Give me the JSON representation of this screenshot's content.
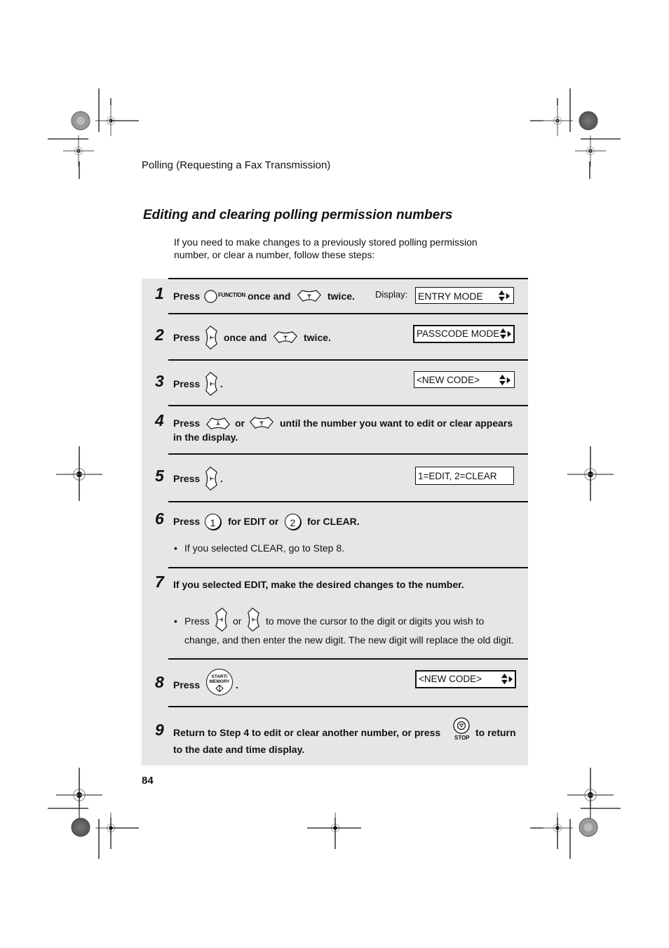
{
  "header": {
    "running_title": "Polling (Requesting a Fax Transmission)"
  },
  "section": {
    "title": "Editing and clearing polling permission numbers",
    "intro_line1": "If you need to make changes to a previously stored polling permission",
    "intro_line2": "number, or clear a number, follow these steps:"
  },
  "display_label": "Display:",
  "steps": [
    {
      "number": "1",
      "press": "Press",
      "function_label": "FUNCTION",
      "mid": "once and",
      "end": "twice.",
      "display": "ENTRY MODE"
    },
    {
      "number": "2",
      "press": "Press",
      "mid": "once and",
      "end": "twice.",
      "display": "PASSCODE MODE"
    },
    {
      "number": "3",
      "press": "Press",
      "end": ".",
      "display": "<NEW CODE>"
    },
    {
      "number": "4",
      "press": "Press",
      "mid": "or",
      "end": "until the number you want to edit or clear appears",
      "line2": "in the display."
    },
    {
      "number": "5",
      "press": "Press",
      "end": ".",
      "display": "1=EDIT, 2=CLEAR"
    },
    {
      "number": "6",
      "press": "Press",
      "key1": "1",
      "mid": "for EDIT or",
      "key2": "2",
      "end": "for CLEAR.",
      "bullet": "If you selected CLEAR, go to Step 8."
    },
    {
      "number": "7",
      "text": "If you selected EDIT, make the desired changes to the number.",
      "bullet_press": "Press",
      "bullet_or": "or",
      "bullet_end": "to move the cursor to the digit or digits you wish to",
      "bullet_line2": "change, and then enter the new digit. The new digit will replace the old digit."
    },
    {
      "number": "8",
      "press": "Press",
      "key_line1": "START/",
      "key_line2": "MEMORY",
      "end": ".",
      "display": "<NEW CODE>"
    },
    {
      "number": "9",
      "text": "Return to Step 4 to edit or clear another number, or press",
      "stop_label": "STOP",
      "end": "to return",
      "line2": "to the date and time display."
    }
  ],
  "footer": {
    "page_number": "84"
  }
}
